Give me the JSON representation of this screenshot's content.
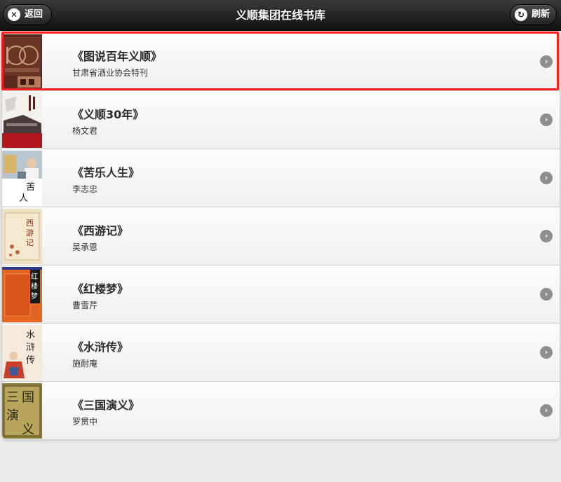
{
  "header": {
    "title": "义顺集团在线书库",
    "back_label": "返回",
    "refresh_label": "刷新"
  },
  "books": [
    {
      "title": "《图说百年义顺》",
      "author": "甘肃省酒业协会特刊"
    },
    {
      "title": "《义顺30年》",
      "author": "杨文君"
    },
    {
      "title": "《苦乐人生》",
      "author": "李志忠"
    },
    {
      "title": "《西游记》",
      "author": "吴承恩"
    },
    {
      "title": "《红楼梦》",
      "author": "曹雪芹"
    },
    {
      "title": "《水浒传》",
      "author": "施耐庵"
    },
    {
      "title": "《三国演义》",
      "author": "罗贯中"
    }
  ],
  "colors": {
    "highlight": "#ff1e1e",
    "header_bg": "#1e1e1e"
  }
}
